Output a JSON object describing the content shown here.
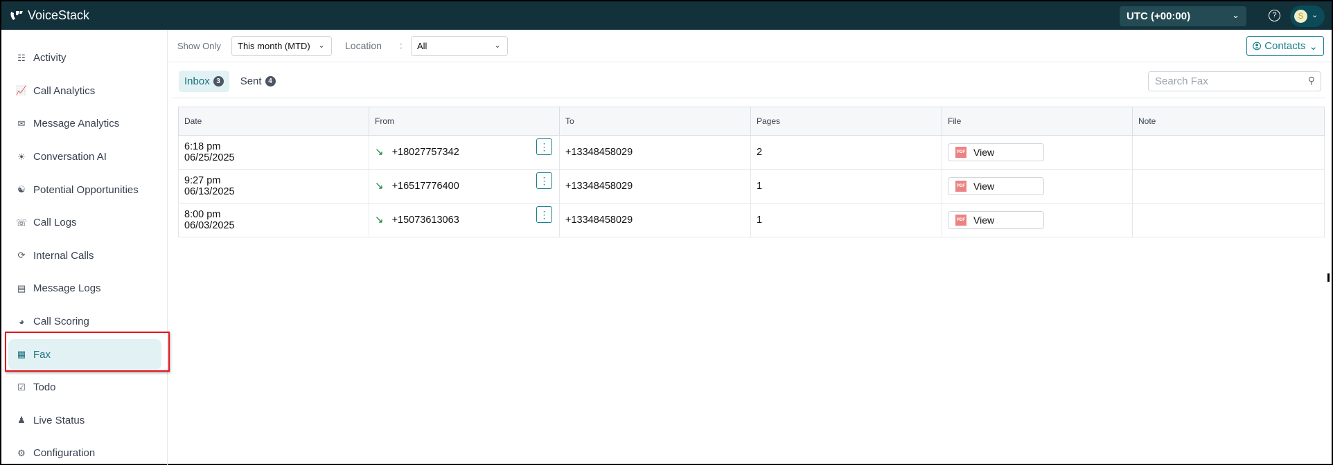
{
  "app": {
    "title": "VoiceStack",
    "timezone": "UTC (+00:00)",
    "help_icon": "?",
    "avatar_initial": "S"
  },
  "sidebar": {
    "items": [
      {
        "label": "Activity",
        "icon": "activity-icon"
      },
      {
        "label": "Call Analytics",
        "icon": "chart-icon"
      },
      {
        "label": "Message Analytics",
        "icon": "message-analytics-icon"
      },
      {
        "label": "Conversation AI",
        "icon": "lightbulb-icon"
      },
      {
        "label": "Potential Opportunities",
        "icon": "opportunities-icon"
      },
      {
        "label": "Call Logs",
        "icon": "phone-icon"
      },
      {
        "label": "Internal Calls",
        "icon": "internal-calls-icon"
      },
      {
        "label": "Message Logs",
        "icon": "message-icon"
      },
      {
        "label": "Call Scoring",
        "icon": "gauge-icon"
      },
      {
        "label": "Fax",
        "icon": "fax-icon",
        "active": true
      },
      {
        "label": "Todo",
        "icon": "todo-icon"
      },
      {
        "label": "Live Status",
        "icon": "live-status-icon"
      },
      {
        "label": "Configuration",
        "icon": "gear-icon"
      }
    ]
  },
  "filters": {
    "show_only_label": "Show Only",
    "show_only_value": "This month (MTD)",
    "location_label": "Location",
    "location_colon": ":",
    "location_value": "All",
    "contacts_label": "Contacts"
  },
  "tabs": [
    {
      "label": "Inbox",
      "count": "3"
    },
    {
      "label": "Sent",
      "count": "4"
    }
  ],
  "search": {
    "placeholder": "Search Fax"
  },
  "table": {
    "headers": [
      "Date",
      "From",
      "To",
      "Pages",
      "File",
      "Note"
    ],
    "rows": [
      {
        "time": "6:18 pm",
        "date": "06/25/2025",
        "from": "+18027757342",
        "to": "+13348458029",
        "pages": "2",
        "file": "View",
        "note": ""
      },
      {
        "time": "9:27 pm",
        "date": "06/13/2025",
        "from": "+16517776400",
        "to": "+13348458029",
        "pages": "1",
        "file": "View",
        "note": ""
      },
      {
        "time": "8:00 pm",
        "date": "06/03/2025",
        "from": "+15073613063",
        "to": "+13348458029",
        "pages": "1",
        "file": "View",
        "note": ""
      }
    ],
    "pdf_label": "PDF"
  },
  "colors": {
    "topbar": "#12313b",
    "accent": "#16808e",
    "active_bg": "#e2f1f4"
  }
}
